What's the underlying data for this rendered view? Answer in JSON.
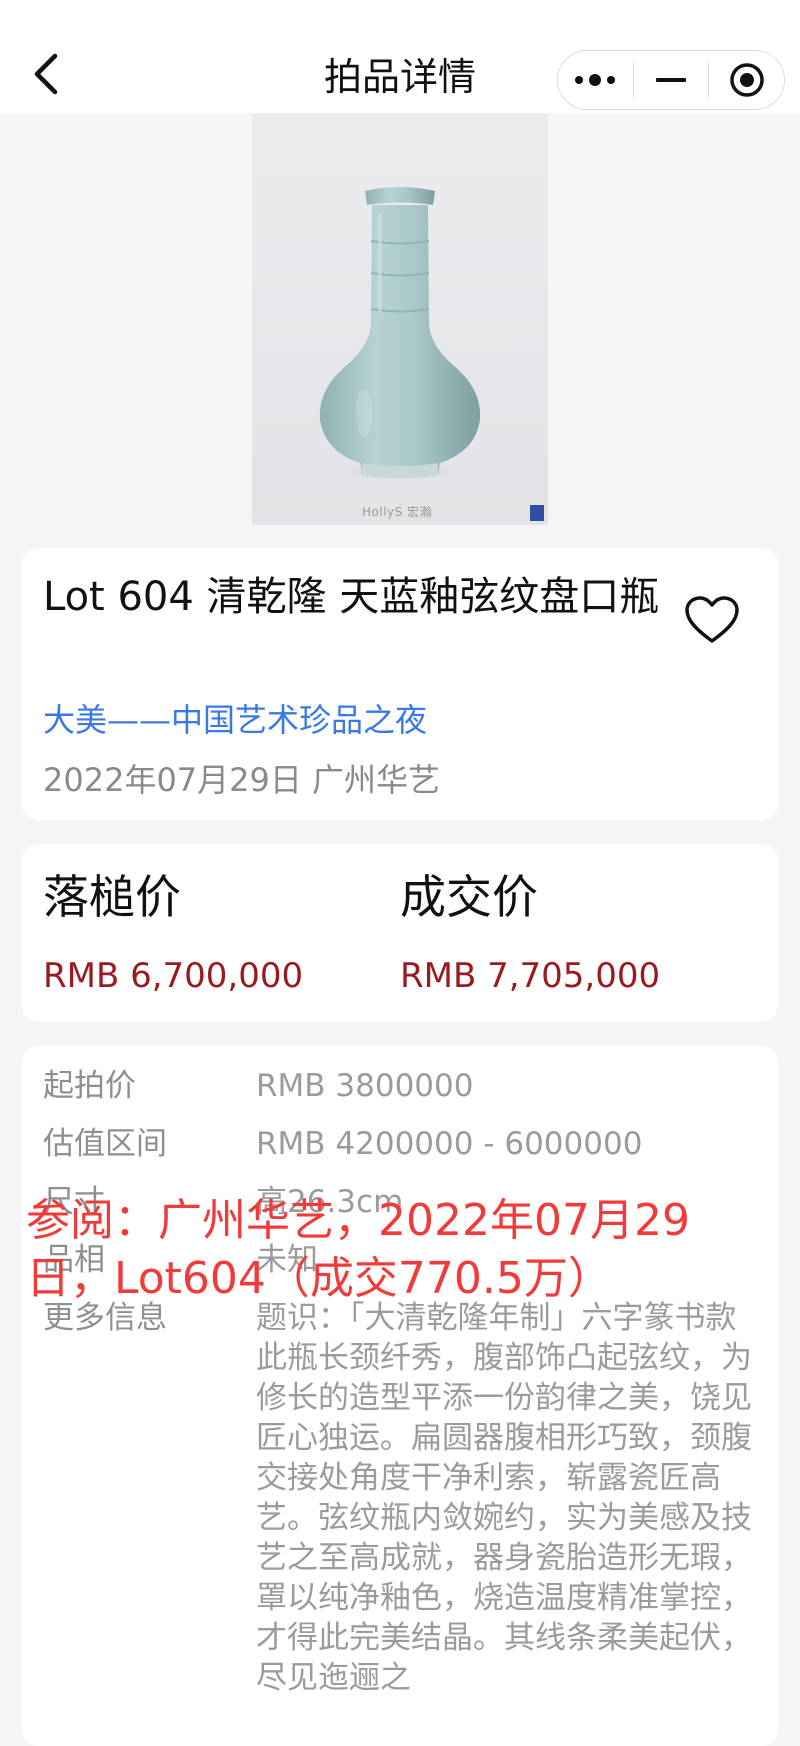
{
  "navbar": {
    "title": "拍品详情",
    "capsule": {
      "more_icon": "more-dots-icon",
      "minimize_icon": "minimize-icon",
      "close_icon": "target-close-icon"
    }
  },
  "product": {
    "image_watermark": "HollyS 宏瀚",
    "title": "Lot 604 清乾隆 天蓝釉弦纹盘口瓶",
    "session_link": "大美——中国艺术珍品之夜",
    "sale_meta": "2022年07月29日 广州华艺"
  },
  "prices": {
    "hammer_label": "落槌价",
    "hammer_value": "RMB 6,700,000",
    "final_label": "成交价",
    "final_value": "RMB 7,705,000"
  },
  "details": [
    {
      "key": "起拍价",
      "value": "RMB 3800000"
    },
    {
      "key": "估值区间",
      "value": "RMB 4200000 - 6000000"
    },
    {
      "key": "尺寸",
      "value": "高26.3cm"
    },
    {
      "key": "品相",
      "value": "未知"
    },
    {
      "key": "更多信息",
      "value": "题识：「大清乾隆年制」六字篆书款此瓶长颈纤秀，腹部饰凸起弦纹，为修长的造型平添一份韵律之美，饶见匠心独运。扁圆器腹相形巧致，颈腹交接处角度干净利索，崭露瓷匠高艺。弦纹瓶内敛婉约，实为美感及技艺之至高成就，器身瓷胎造形无瑕，罩以纯净釉色，烧造温度精准掌控，才得此完美结晶。其线条柔美起伏，尽见迤逦之"
    }
  ],
  "overlay": {
    "note": "参阅：广州华艺，2022年07月29日，Lot604（成交770.5万）"
  },
  "colors": {
    "accent_link": "#3a78e6",
    "price_red": "#9a1b1f",
    "overlay_red": "#f23a3a",
    "vase_glaze": "#a9c7c9"
  }
}
